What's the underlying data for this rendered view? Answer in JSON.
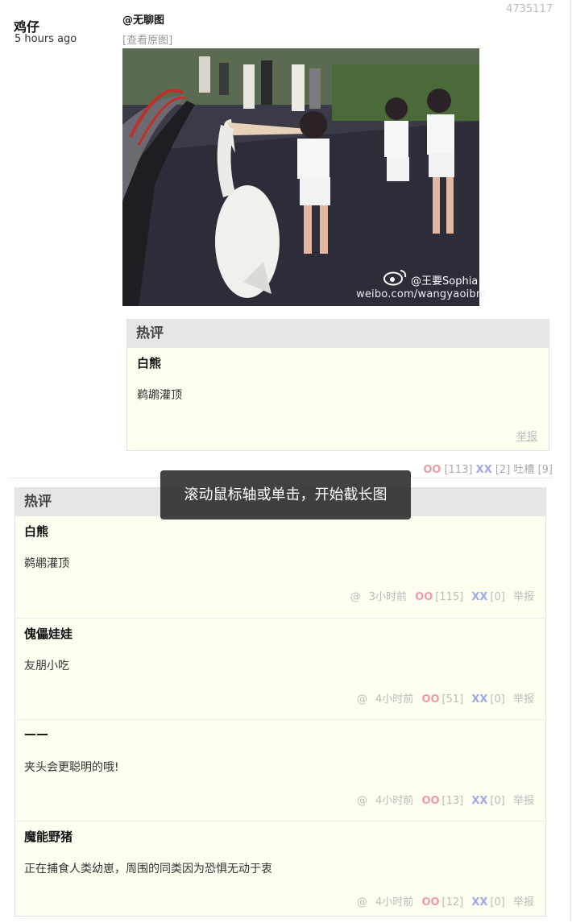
{
  "post": {
    "id": "4735117",
    "author": "鸡仔",
    "time": "5 hours ago",
    "source": "@无聊图",
    "view_original": "[查看原图]",
    "watermark_user": "@王要Sophia",
    "watermark_site": "weibo.com/wangyaoibm"
  },
  "hot_top": {
    "heading": "热评",
    "name": "白熊",
    "text": "鹈鹕灌顶",
    "report": "举报"
  },
  "post_actions": {
    "oo_label": "OO",
    "oo_count": "[113]",
    "xx_label": "XX",
    "xx_count": "[2]",
    "tucao_label": "吐槽",
    "tucao_count": "[9]"
  },
  "hot_comments": {
    "heading": "热评",
    "items": [
      {
        "name": "白熊",
        "text": "鹈鹕灌顶",
        "at": "@",
        "time": "3小时前",
        "oo": "OO",
        "oo_count": "[115]",
        "xx": "XX",
        "xx_count": "[0]",
        "report": "举报"
      },
      {
        "name": "傀儡娃娃",
        "text": "友朋小吃",
        "at": "@",
        "time": "4小时前",
        "oo": "OO",
        "oo_count": "[51]",
        "xx": "XX",
        "xx_count": "[0]",
        "report": "举报"
      },
      {
        "name": "——",
        "text": "夹头会更聪明的哦!",
        "at": "@",
        "time": "4小时前",
        "oo": "OO",
        "oo_count": "[13]",
        "xx": "XX",
        "xx_count": "[0]",
        "report": "举报"
      },
      {
        "name": "魔能野猪",
        "text": "正在捕食人类幼崽，周围的同类因为恐惧无动于衷",
        "at": "@",
        "time": "4小时前",
        "oo": "OO",
        "oo_count": "[12]",
        "xx": "XX",
        "xx_count": "[0]",
        "report": "举报"
      }
    ]
  },
  "toast": {
    "text": "滚动鼠标轴或单击，开始截长图"
  },
  "colors": {
    "oo": "#f29aa6",
    "xx": "#9da8ee",
    "comment_bg": "#fefff0",
    "header_bg": "#e6e6e6"
  }
}
